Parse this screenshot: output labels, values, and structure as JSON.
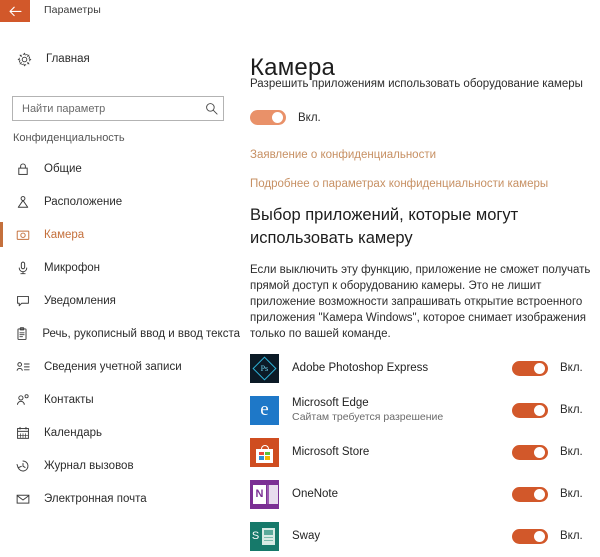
{
  "window": {
    "title": "Параметры",
    "back_icon": "back-arrow-icon"
  },
  "sidebar": {
    "home": {
      "label": "Главная",
      "icon": "gear-icon"
    },
    "search": {
      "placeholder": "Найти параметр",
      "value": "",
      "icon": "search-icon"
    },
    "section_header": "Конфиденциальность",
    "items": [
      {
        "label": "Общие",
        "icon": "lock-icon",
        "active": false
      },
      {
        "label": "Расположение",
        "icon": "location-pin-icon",
        "active": false
      },
      {
        "label": "Камера",
        "icon": "camera-icon",
        "active": true
      },
      {
        "label": "Микрофон",
        "icon": "microphone-icon",
        "active": false
      },
      {
        "label": "Уведомления",
        "icon": "notification-icon",
        "active": false
      },
      {
        "label": "Речь, рукописный ввод и ввод текста",
        "icon": "clipboard-pen-icon",
        "active": false
      },
      {
        "label": "Сведения учетной записи",
        "icon": "account-info-icon",
        "active": false
      },
      {
        "label": "Контакты",
        "icon": "contacts-icon",
        "active": false
      },
      {
        "label": "Календарь",
        "icon": "calendar-icon",
        "active": false
      },
      {
        "label": "Журнал вызовов",
        "icon": "call-history-icon",
        "active": false
      },
      {
        "label": "Электронная почта",
        "icon": "mail-icon",
        "active": false
      }
    ]
  },
  "main": {
    "page_title": "Камера",
    "master_setting": {
      "description": "Разрешить приложениям использовать оборудование камеры",
      "state_label": "Вкл.",
      "on": true
    },
    "links": [
      "Заявление о конфиденциальности",
      "Подробнее о параметрах конфиденциальности камеры"
    ],
    "section_title": "Выбор приложений, которые могут использовать камеру",
    "section_description": "Если выключить эту функцию, приложение не сможет получать прямой доступ к оборудованию камеры. Это не лишит приложение возможности запрашивать открытие встроенного приложения \"Камера Windows\", которое снимает изображения только по вашей команде.",
    "apps": [
      {
        "name": "Adobe Photoshop Express",
        "sub": "",
        "icon": "photoshop-express-icon",
        "state_label": "Вкл.",
        "on": true
      },
      {
        "name": "Microsoft Edge",
        "sub": "Сайтам требуется разрешение",
        "icon": "microsoft-edge-icon",
        "state_label": "Вкл.",
        "on": true
      },
      {
        "name": "Microsoft Store",
        "sub": "",
        "icon": "microsoft-store-icon",
        "state_label": "Вкл.",
        "on": true
      },
      {
        "name": "OneNote",
        "sub": "",
        "icon": "onenote-icon",
        "state_label": "Вкл.",
        "on": true
      },
      {
        "name": "Sway",
        "sub": "",
        "icon": "sway-icon",
        "state_label": "Вкл.",
        "on": true
      }
    ]
  },
  "colors": {
    "accent": "#d2582a",
    "accent_light": "#e99169",
    "link": "#c79063",
    "active_nav": "#c4703c"
  }
}
